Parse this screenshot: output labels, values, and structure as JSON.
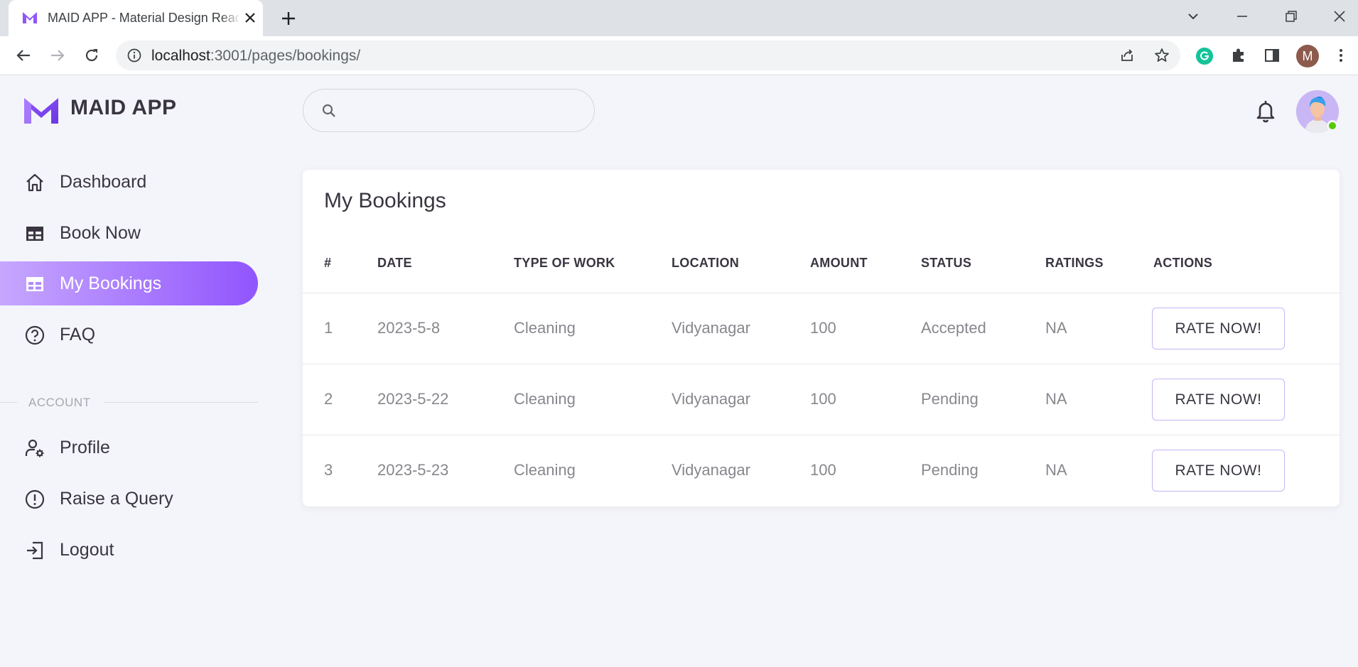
{
  "browser": {
    "tab_title": "MAID APP - Material Design React Admin Template",
    "url_host": "localhost",
    "url_rest": ":3001/pages/bookings/",
    "profile_initial": "M"
  },
  "app": {
    "brand": "MAID APP",
    "accent_color": "#9155fd",
    "search": {
      "placeholder": "",
      "value": ""
    }
  },
  "sidebar": {
    "items": [
      {
        "label": "Dashboard",
        "icon": "home-icon",
        "active": false
      },
      {
        "label": "Book Now",
        "icon": "table-icon",
        "active": false
      },
      {
        "label": "My Bookings",
        "icon": "grid-icon",
        "active": true
      },
      {
        "label": "FAQ",
        "icon": "help-circle-icon",
        "active": false
      }
    ],
    "section_label": "ACCOUNT",
    "account_items": [
      {
        "label": "Profile",
        "icon": "user-settings-icon"
      },
      {
        "label": "Raise a Query",
        "icon": "alert-circle-icon"
      },
      {
        "label": "Logout",
        "icon": "logout-icon"
      }
    ]
  },
  "bookings": {
    "title": "My Bookings",
    "columns": [
      "#",
      "DATE",
      "TYPE OF WORK",
      "LOCATION",
      "AMOUNT",
      "STATUS",
      "RATINGS",
      "ACTIONS"
    ],
    "rows": [
      {
        "num": "1",
        "date": "2023-5-8",
        "type": "Cleaning",
        "location": "Vidyanagar",
        "amount": "100",
        "status": "Accepted",
        "rating": "NA",
        "action": "RATE NOW!"
      },
      {
        "num": "2",
        "date": "2023-5-22",
        "type": "Cleaning",
        "location": "Vidyanagar",
        "amount": "100",
        "status": "Pending",
        "rating": "NA",
        "action": "RATE NOW!"
      },
      {
        "num": "3",
        "date": "2023-5-23",
        "type": "Cleaning",
        "location": "Vidyanagar",
        "amount": "100",
        "status": "Pending",
        "rating": "NA",
        "action": "RATE NOW!"
      }
    ]
  }
}
